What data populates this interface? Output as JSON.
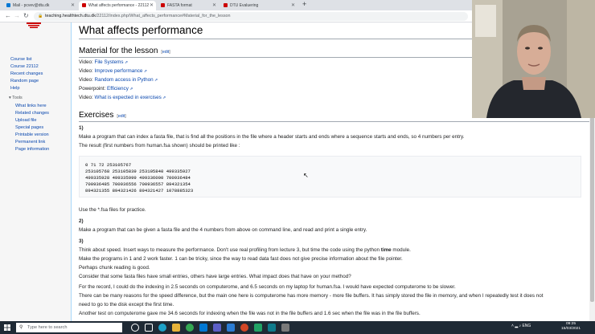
{
  "browser": {
    "tabs": [
      {
        "label": "Mail - pcvev@dtu.dk"
      },
      {
        "label": "What affects performance - 22112"
      },
      {
        "label": "FASTA format"
      },
      {
        "label": "DTU Evaluering"
      }
    ],
    "url_host": "teaching.healthtech.dtu.dk",
    "url_path": "/22112/index.php/What_affects_performance#Material_for_the_lesson"
  },
  "sidebar": {
    "nav": [
      "Course list",
      "Course 22112",
      "Recent changes",
      "Random page",
      "Help"
    ],
    "tools_label": "Tools",
    "tools": [
      "What links here",
      "Related changes",
      "Upload file",
      "Special pages",
      "Printable version",
      "Permanent link",
      "Page information"
    ]
  },
  "page": {
    "title": "What affects performance",
    "edit_label": "edit",
    "material_heading": "Material for the lesson",
    "materials": [
      {
        "prefix": "Video:",
        "link": "File Systems"
      },
      {
        "prefix": "Video:",
        "link": "Improve performance"
      },
      {
        "prefix": "Video:",
        "link": "Random access in Python"
      },
      {
        "prefix": "Powerpoint:",
        "link": "Efficiency"
      },
      {
        "prefix": "Video:",
        "link": "What is expected in exercises"
      }
    ],
    "exercises_heading": "Exercises",
    "ex1_num": "1)",
    "ex1_text": "Make a program that can index a fasta file, that is find all the positions in the file where a header starts and ends where a sequence starts and ends, so 4 numbers per entry.",
    "ex1_result": "The result (first numbers from human.fsa shown) should be printed like :",
    "code_lines": [
      "0 71 72 253105767",
      "253105768 253105839 253105840 499335927",
      "499335928 499335999 499336000 700936484",
      "700936485 700936556 700936557 894321354",
      "894321355 894321426 894321427 1078885323"
    ],
    "ex1_note": "Use the *.fsa files for practice.",
    "ex2_num": "2)",
    "ex2_text": "Make a program that can be given a fasta file and the 4 numbers from above on command line, and read and print a single entry.",
    "ex3_num": "3)",
    "ex3_line1_a": "Think about speed. Insert ways to measure the performance. Don't use real profiling from lecture 3, but time the code using the python ",
    "ex3_line1_b": "time",
    "ex3_line1_c": " module.",
    "ex3_line2": "Make the programs in 1 and 2 work faster. 1 can be tricky, since the way to read data fast does not give precise information about the file pointer.",
    "ex3_line3": "Perhaps chunk reading is good.",
    "ex3_line4": "Consider that some fasta files have small entries, others have large entries. What impact does that have on your method?",
    "ex3_line5": "For the record, I could do the indexing in 2.5 seconds on computerome, and 6.5 seconds on my laptop for human.fsa. I would have expected computerome to be slower.",
    "ex3_line6": "There can be many reasons for the speed difference, but the main one here is computerome has more memory - more file buffers. It has simply stored the file in memory, and when I repeatedly test it does not",
    "ex3_line7": "need to go to the disk except the first time.",
    "ex3_line8": "Another test on computerome gave me 34.6 seconds for indexing when the file was not in the file buffers and 1.6 sec when the file was in the file buffers."
  },
  "taskbar": {
    "search_placeholder": "Type here to search",
    "tray": "ENG",
    "time": "09:25",
    "date": "15/03/2021"
  }
}
